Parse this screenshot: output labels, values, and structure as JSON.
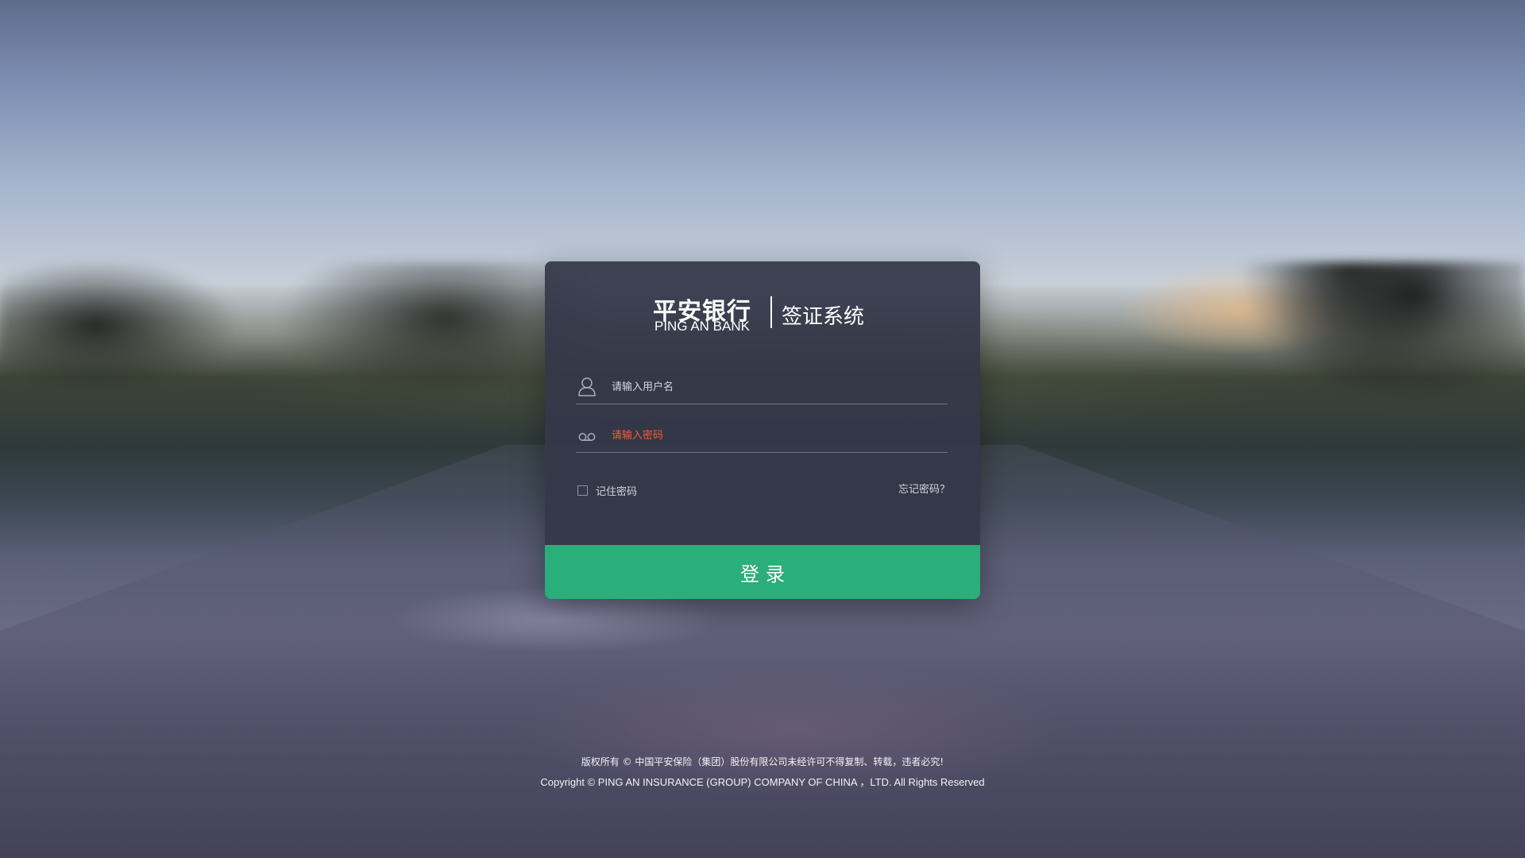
{
  "brand": {
    "name_cn": "平安银行",
    "name_en": "PING AN BANK",
    "system_name": "签证系统"
  },
  "login_form": {
    "username_placeholder": "请输入用户名",
    "password_placeholder": "请输入密码",
    "remember_label": "记住密码",
    "remember_checked": false,
    "forgot_label": "忘记密码？",
    "submit_label": "登录"
  },
  "footer": {
    "copyright_cn": "版权所有 © 中国平安保险（集团）股份有限公司未经许可不得复制、转载，违者必究!",
    "copyright_en": "Copyright © PING AN INSURANCE (GROUP) COMPANY OF CHINA ，LTD. All Rights Reserved"
  },
  "colors": {
    "card_bg": "#343748",
    "accent_green": "#2aae7a",
    "password_placeholder": "#ff5a2c"
  },
  "icons": {
    "username": "user-icon",
    "password": "password-icon"
  }
}
